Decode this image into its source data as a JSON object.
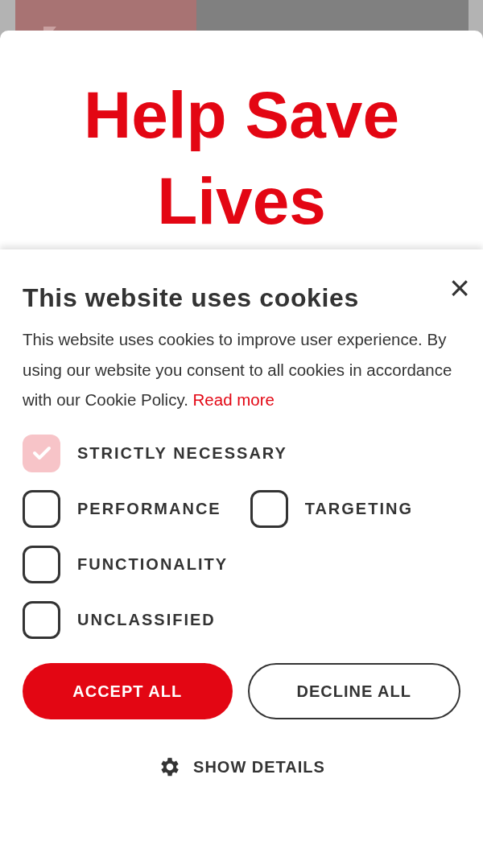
{
  "hero": {
    "title": "Help Save Lives"
  },
  "cookie_banner": {
    "title": "This website uses cookies",
    "close": "×",
    "text": "This website uses cookies to improve user experience. By using our website you consent to all cookies in accordance with our Cookie Policy.",
    "link": "Read more",
    "options": [
      {
        "label": "STRICTLY NECESSARY",
        "checked": true,
        "disabled": true
      },
      {
        "label": "PERFORMANCE",
        "checked": false,
        "disabled": false
      },
      {
        "label": "TARGETING",
        "checked": false,
        "disabled": false
      },
      {
        "label": "FUNCTIONALITY",
        "checked": false,
        "disabled": false
      },
      {
        "label": "UNCLASSIFIED",
        "checked": false,
        "disabled": false
      }
    ],
    "buttons": [
      {
        "label": "ACCEPT ALL",
        "kind": "primary"
      },
      {
        "label": "DECLINE ALL",
        "kind": "secondary"
      }
    ],
    "details": "SHOW DETAILS"
  }
}
